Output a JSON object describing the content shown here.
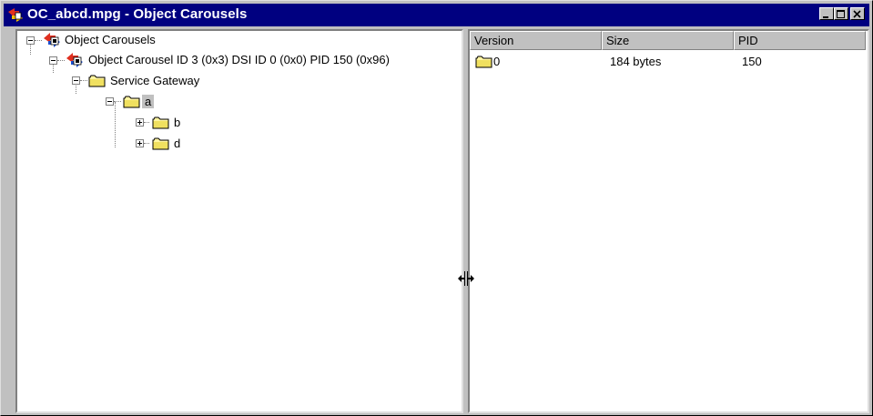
{
  "window": {
    "title": "OC_abcd.mpg - Object Carousels"
  },
  "titlebar_buttons": [
    "minimize",
    "maximize",
    "close"
  ],
  "tree": {
    "root": "Object Carousels",
    "carousel": "Object Carousel ID 3 (0x3) DSI ID 0 (0x0) PID 150 (0x96)",
    "gateway": "Service Gateway",
    "folder_a": "a",
    "folder_b": "b",
    "folder_d": "d"
  },
  "list": {
    "columns": [
      "Version",
      "Size",
      "PID"
    ],
    "rows": [
      {
        "version": "0",
        "size": "184 bytes",
        "pid": "150"
      }
    ]
  },
  "icons": [
    "app-icon",
    "carousel-icon",
    "folder-icon",
    "split-cursor-icon"
  ]
}
